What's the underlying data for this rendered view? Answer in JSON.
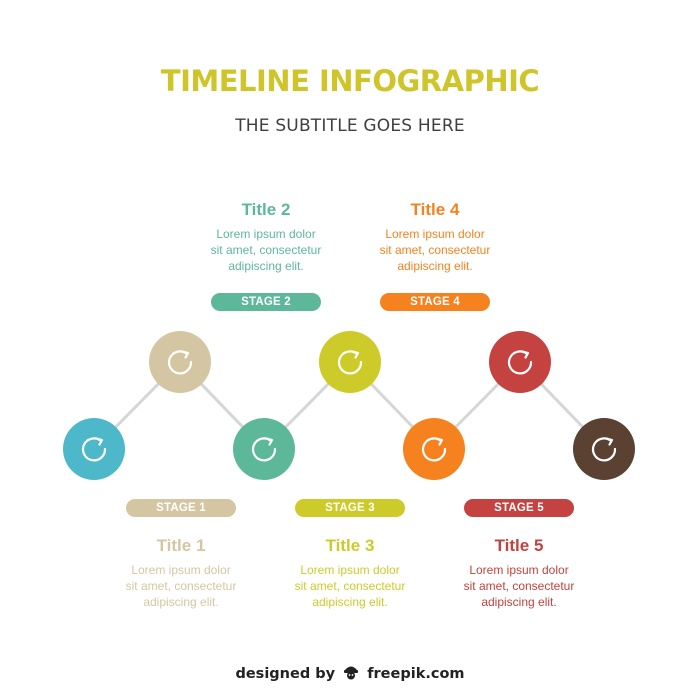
{
  "header": {
    "title": "TIMELINE INFOGRAPHIC",
    "subtitle": "THE SUBTITLE GOES HERE"
  },
  "stages": [
    {
      "pill": "STAGE 1",
      "title": "Title 1",
      "desc": [
        "Lorem ipsum dolor",
        "sit amet, consectetur",
        "adipiscing elit."
      ],
      "color": "#d4c6a2",
      "position": "below",
      "node_level": "low",
      "icon": "refresh-icon"
    },
    {
      "pill": "STAGE 2",
      "title": "Title 2",
      "desc": [
        "Lorem ipsum dolor",
        "sit amet, consectetur",
        "adipiscing elit."
      ],
      "color": "#5db89a",
      "position": "above",
      "node_level": "high",
      "icon": "refresh-icon"
    },
    {
      "pill": "STAGE 3",
      "title": "Title 3",
      "desc": [
        "Lorem ipsum dolor",
        "sit amet, consectetur",
        "adipiscing elit."
      ],
      "color": "#cdcb2a",
      "position": "below",
      "node_level": "low",
      "icon": "refresh-icon"
    },
    {
      "pill": "STAGE 4",
      "title": "Title 4",
      "desc": [
        "Lorem ipsum dolor",
        "sit amet, consectetur",
        "adipiscing elit."
      ],
      "color": "#f5821f",
      "position": "above",
      "node_level": "high",
      "icon": "refresh-icon"
    },
    {
      "pill": "STAGE 5",
      "title": "Title 5",
      "desc": [
        "Lorem ipsum dolor",
        "sit amet, consectetur",
        "adipiscing elit."
      ],
      "color": "#c4423f",
      "position": "below",
      "node_level": "low",
      "icon": "refresh-icon"
    }
  ],
  "nodes": [
    {
      "color": "#4db8c9",
      "icon": "refresh-icon"
    },
    {
      "color": "#d4c6a2",
      "icon": "refresh-icon"
    },
    {
      "color": "#5db89a",
      "icon": "refresh-icon"
    },
    {
      "color": "#cdcb2a",
      "icon": "refresh-icon"
    },
    {
      "color": "#f5821f",
      "icon": "refresh-icon"
    },
    {
      "color": "#c4423f",
      "icon": "refresh-icon"
    },
    {
      "color": "#5a4132",
      "icon": "refresh-icon"
    }
  ],
  "footer": {
    "prefix": "designed by",
    "brand": "freepik.com",
    "icon": "freepik-logo-icon"
  }
}
